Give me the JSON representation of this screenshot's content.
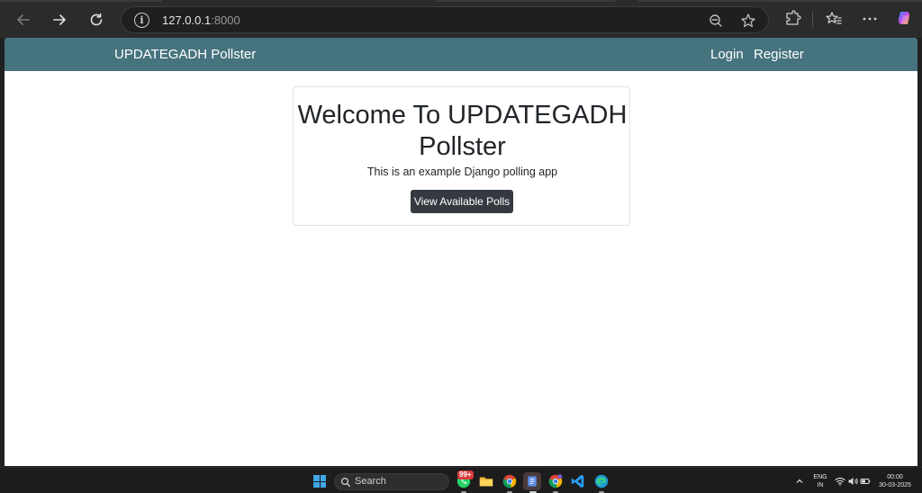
{
  "browser": {
    "url_host": "127.0.0.1",
    "url_port": ":8000",
    "icons": [
      "back-icon",
      "forward-icon",
      "reload-icon",
      "site-info-icon",
      "zoom-out-icon",
      "favorite-star-icon",
      "extensions-icon",
      "favorites-icon",
      "more-icon",
      "copilot-icon"
    ]
  },
  "app": {
    "brand": "UPDATEGADH Pollster",
    "nav": {
      "login": "Login",
      "register": "Register"
    },
    "nav_color": "#45737e"
  },
  "hero": {
    "title": "Welcome To UPDATEGADH Pollster",
    "subtitle": "This is an example Django polling app",
    "button_label": "View Available Polls",
    "button_color": "#343a40"
  },
  "taskbar": {
    "search_label": "Search",
    "badge_count": "99+",
    "lang_top": "ENG",
    "lang_bottom": "IN",
    "time": "00:00",
    "date": "30-03-2025",
    "apps": [
      "whatsapp-icon",
      "file-explorer-icon",
      "chrome-icon",
      "notepad-icon",
      "chrome-profile-icon",
      "vscode-icon",
      "edge-icon"
    ]
  }
}
